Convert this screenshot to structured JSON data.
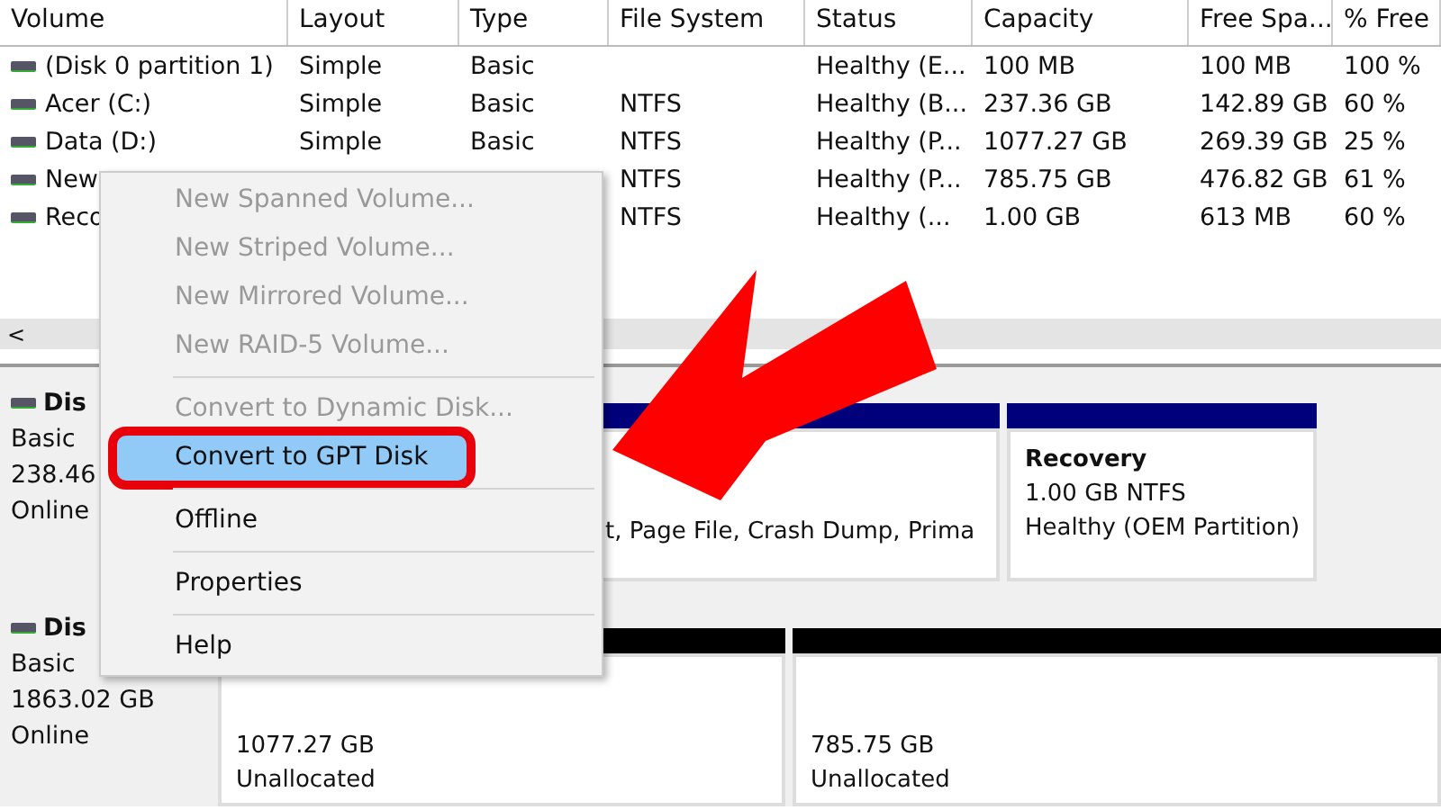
{
  "volume_table": {
    "columns": [
      "Volume",
      "Layout",
      "Type",
      "File System",
      "Status",
      "Capacity",
      "Free Spa...",
      "% Free"
    ],
    "rows": [
      {
        "volume": "(Disk 0 partition 1)",
        "layout": "Simple",
        "type": "Basic",
        "file_system": "",
        "status": "Healthy (E...",
        "capacity": "100 MB",
        "free_space": "100 MB",
        "percent_free": "100 %"
      },
      {
        "volume": "Acer (C:)",
        "layout": "Simple",
        "type": "Basic",
        "file_system": "NTFS",
        "status": "Healthy (B...",
        "capacity": "237.36 GB",
        "free_space": "142.89 GB",
        "percent_free": "60 %"
      },
      {
        "volume": "Data (D:)",
        "layout": "Simple",
        "type": "Basic",
        "file_system": "NTFS",
        "status": "Healthy (P...",
        "capacity": "1077.27 GB",
        "free_space": "269.39 GB",
        "percent_free": "25 %"
      },
      {
        "volume": "New",
        "layout": "",
        "type": "",
        "file_system": "NTFS",
        "status": "Healthy (P...",
        "capacity": "785.75 GB",
        "free_space": "476.82 GB",
        "percent_free": "61 %"
      },
      {
        "volume": "Reco",
        "layout": "",
        "type": "",
        "file_system": "NTFS",
        "status": "Healthy (...",
        "capacity": "1.00 GB",
        "free_space": "613 MB",
        "percent_free": "60 %"
      }
    ],
    "scroll_left": "<"
  },
  "disks": [
    {
      "name": "Dis",
      "lines": [
        "Basic",
        "238.46",
        "Online"
      ],
      "partitions": [
        {
          "kind": "primary",
          "lines": [
            "t, Page File, Crash Dump, Prima"
          ]
        },
        {
          "kind": "primary",
          "title": "Recovery",
          "lines": [
            "1.00 GB NTFS",
            "Healthy (OEM Partition)"
          ]
        }
      ]
    },
    {
      "name": "Dis",
      "lines": [
        "Basic",
        "1863.02 GB",
        "Online"
      ],
      "partitions": [
        {
          "kind": "unallocated",
          "lines": [
            "1077.27 GB",
            "Unallocated"
          ]
        },
        {
          "kind": "unallocated",
          "lines": [
            "785.75 GB",
            "Unallocated"
          ]
        }
      ]
    }
  ],
  "context_menu": {
    "items": [
      {
        "label": "New Spanned Volume...",
        "disabled": true,
        "selected": false,
        "separator_before": false
      },
      {
        "label": "New Striped Volume...",
        "disabled": true,
        "selected": false,
        "separator_before": false
      },
      {
        "label": "New Mirrored Volume...",
        "disabled": true,
        "selected": false,
        "separator_before": false
      },
      {
        "label": "New RAID-5 Volume...",
        "disabled": true,
        "selected": false,
        "separator_before": false
      },
      {
        "label": "Convert to Dynamic Disk...",
        "disabled": true,
        "selected": false,
        "separator_before": true
      },
      {
        "label": "Convert to GPT Disk",
        "disabled": false,
        "selected": true,
        "separator_before": false
      },
      {
        "label": "Offline",
        "disabled": false,
        "selected": false,
        "separator_before": true
      },
      {
        "label": "Properties",
        "disabled": false,
        "selected": false,
        "separator_before": true
      },
      {
        "label": "Help",
        "disabled": false,
        "selected": false,
        "separator_before": true
      }
    ]
  }
}
